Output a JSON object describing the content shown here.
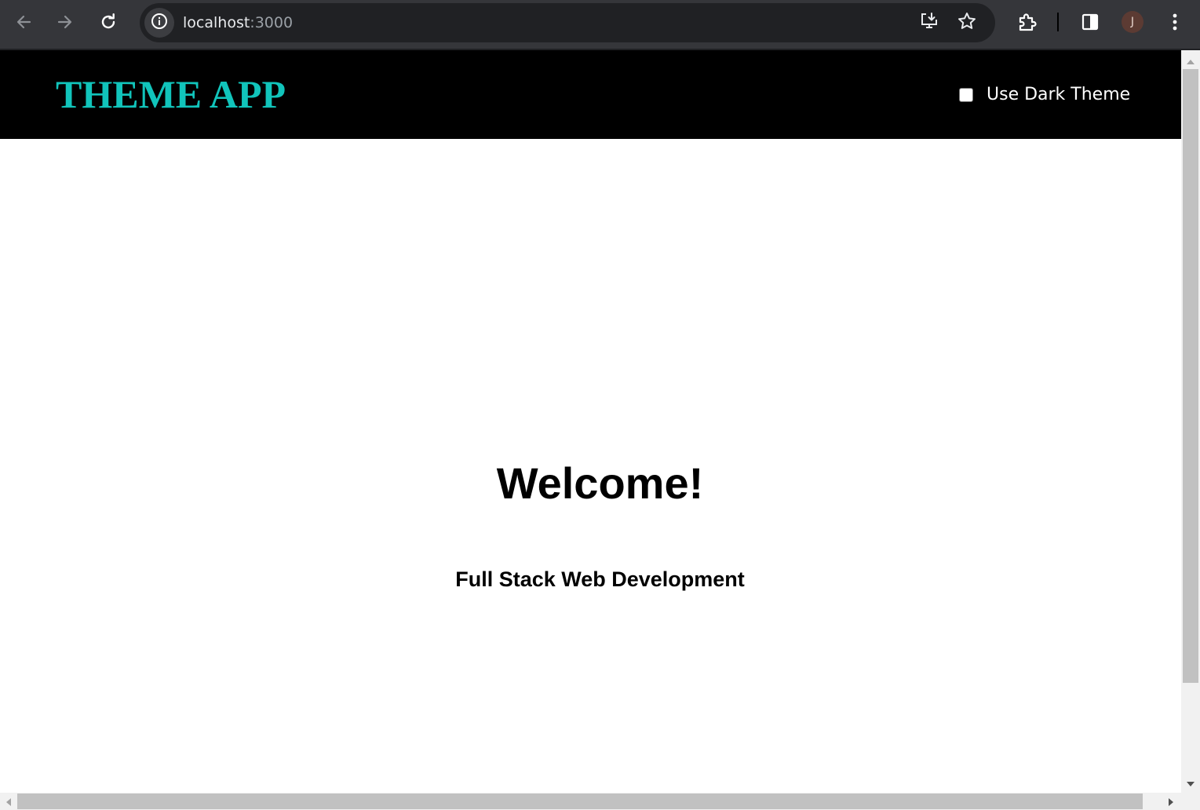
{
  "browser": {
    "url_host": "localhost",
    "url_port": ":3000",
    "profile_initial": "J",
    "icons": {
      "back": "arrow-left-icon",
      "forward": "arrow-right-icon",
      "reload": "reload-icon",
      "site_info": "info-icon",
      "install": "install-app-icon",
      "bookmark": "star-icon",
      "extensions": "puzzle-icon",
      "side_panel": "side-panel-icon",
      "menu": "kebab-menu-icon"
    }
  },
  "app": {
    "title": "THEME APP",
    "title_color": "#11c4bb",
    "header_bg": "#000000",
    "dark_theme_toggle": {
      "label": "Use Dark Theme",
      "checked": false
    },
    "welcome": "Welcome!",
    "subtitle": "Full Stack Web Development"
  }
}
